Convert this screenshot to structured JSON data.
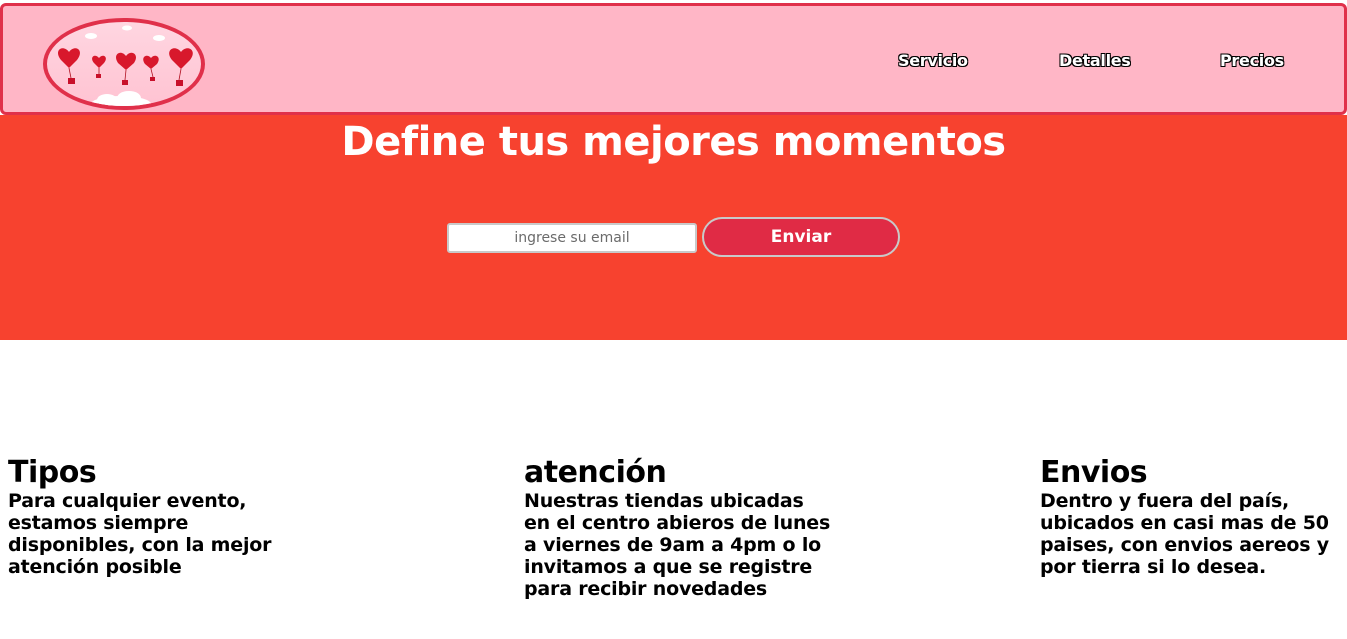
{
  "header": {
    "logo_icon": "heart-balloons-logo",
    "colors": {
      "background": "#ffb6c6",
      "border": "#e0304a"
    },
    "nav": [
      {
        "label": "Servicio"
      },
      {
        "label": "Detalles"
      },
      {
        "label": "Precios"
      }
    ]
  },
  "hero": {
    "title": "Define tus mejores momentos",
    "email_placeholder": "ingrese su email",
    "email_value": "",
    "send_label": "Enviar",
    "colors": {
      "background": "#f7422f",
      "button": "#e02b45"
    }
  },
  "features": [
    {
      "title": "Tipos",
      "text": "Para cualquier evento, estamos siempre disponibles, con la mejor atención posible"
    },
    {
      "title": "atención",
      "text": "Nuestras tiendas ubicadas en el centro abieros de lunes a viernes de 9am a 4pm o lo invitamos a que se registre para recibir novedades"
    },
    {
      "title": "Envios",
      "text": "Dentro y fuera del país, ubicados en casi mas de 50 paises, con envios aereos y por tierra si lo desea."
    }
  ]
}
